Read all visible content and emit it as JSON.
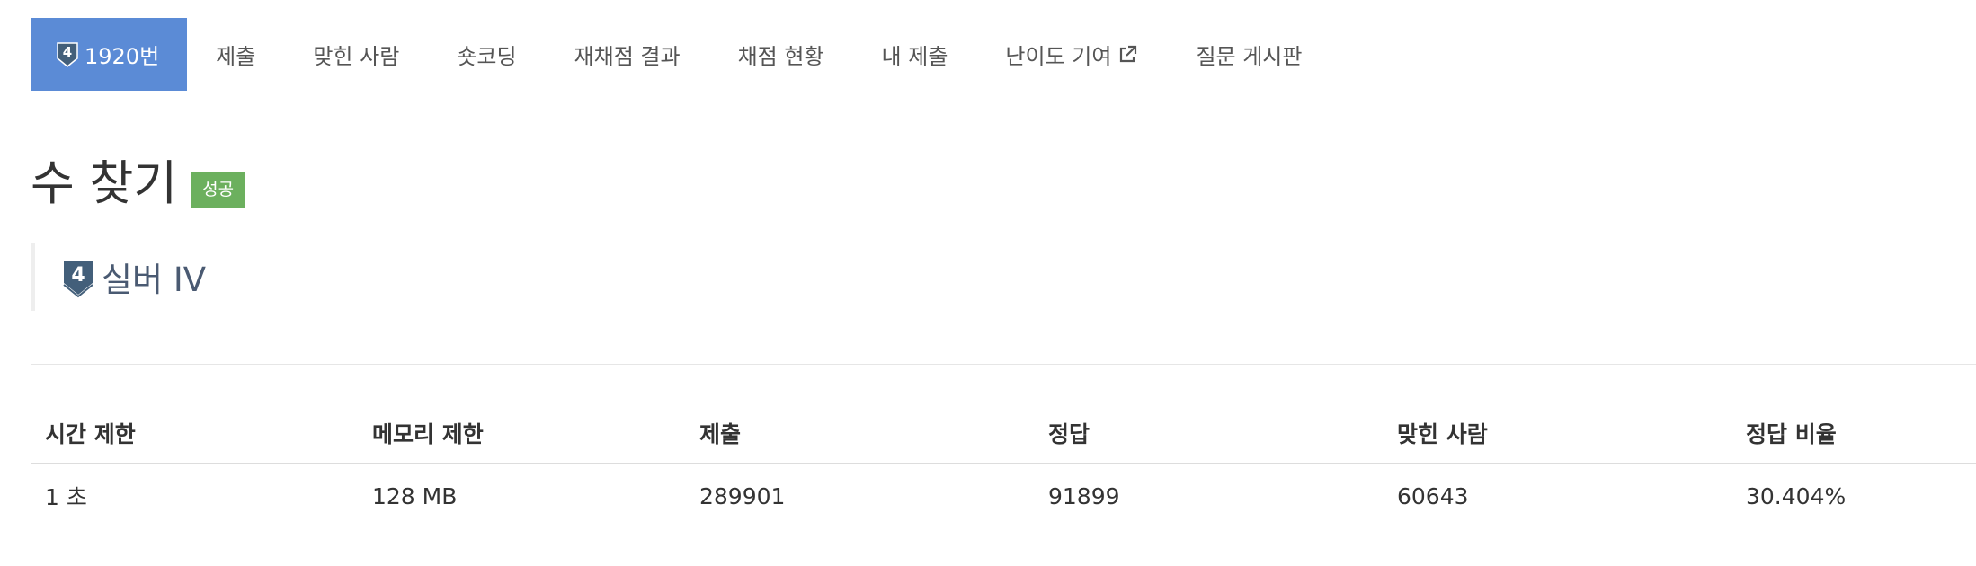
{
  "tabs": [
    {
      "label": "1920번",
      "active": true,
      "icon": "tier-silver-4-icon",
      "icon_text": "4"
    },
    {
      "label": "제출"
    },
    {
      "label": "맞힌 사람"
    },
    {
      "label": "숏코딩"
    },
    {
      "label": "재채점 결과"
    },
    {
      "label": "채점 현황"
    },
    {
      "label": "내 제출"
    },
    {
      "label": "난이도 기여",
      "icon": "external-link-icon"
    },
    {
      "label": "질문 게시판"
    }
  ],
  "problem": {
    "title": "수 찾기",
    "status_badge": "성공",
    "tier_label": "실버 IV",
    "tier_icon_text": "4"
  },
  "stats": {
    "headers": [
      "시간 제한",
      "메모리 제한",
      "제출",
      "정답",
      "맞힌 사람",
      "정답 비율"
    ],
    "values": [
      "1 초",
      "128 MB",
      "289901",
      "91899",
      "60643",
      "30.404%"
    ]
  },
  "colors": {
    "active_tab": "#5b8bd6",
    "success_badge": "#6cb05e",
    "tier_icon": "#435f7a",
    "tier_text": "#4a5a72"
  }
}
